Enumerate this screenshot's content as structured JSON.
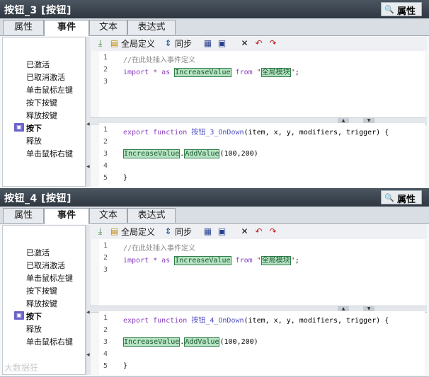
{
  "props_label": "属性",
  "tabs": [
    "属性",
    "事件",
    "文本",
    "表达式"
  ],
  "active_tab": 1,
  "toolbar": {
    "global_label": "全局定义",
    "sync_label": "同步"
  },
  "events_top": [
    "已激活",
    "已取消激活",
    "单击鼠标左键",
    "按下按键",
    "释放按键",
    "按下",
    "释放",
    "单击鼠标右键"
  ],
  "events_bottom": [
    "已激活",
    "已取消激活",
    "单击鼠标左键",
    "按下按键",
    "释放按键",
    "按下",
    "释放",
    "单击鼠标右键"
  ],
  "selected_event": "按下",
  "panel1": {
    "title": "按钮_3 [按钮]",
    "global_code": [
      "//在此处插入事件定义",
      "import * as IncreaseValue from \"全局模块\";",
      ""
    ],
    "func_code": [
      "export function 按钮_3_OnDown(item, x, y, modifiers, trigger) {",
      "",
      "IncreaseValue.AddValue(100,200)",
      "",
      "}"
    ]
  },
  "panel2": {
    "title": "按钮_4 [按钮]",
    "global_code": [
      "//在此处插入事件定义",
      "import * as IncreaseValue from \"全局模块\";",
      ""
    ],
    "func_code": [
      "export function 按钮_4_OnDown(item, x, y, modifiers, trigger) {",
      "",
      "IncreaseValue.AddValue(100,200)",
      "",
      "}"
    ]
  },
  "line_numbers": [
    "1",
    "2",
    "3"
  ],
  "func_line_numbers": [
    "1",
    "2",
    "3",
    "4",
    "5"
  ],
  "code_tokens": {
    "comment": "//在此处插入事件定义",
    "import": "import",
    "star_as": " * as ",
    "module_name": "IncreaseValue",
    "from": " from ",
    "module_str": "全局模块",
    "semicolon": ";",
    "export_function": "export function ",
    "func_params": "(item, x, y, modifiers, trigger) {",
    "add_value": "AddValue",
    "args": "(100,200)",
    "close_brace": "}",
    "func_name_1": "按钮_3_OnDown",
    "func_name_2": "按钮_4_OnDown"
  },
  "watermark": "大数据狂"
}
